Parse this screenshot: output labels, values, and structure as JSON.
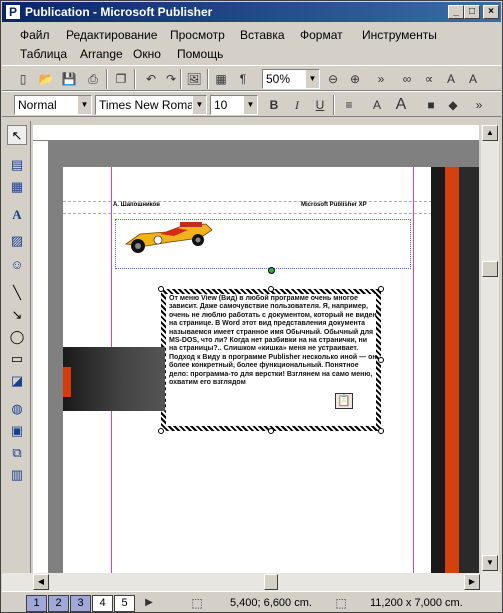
{
  "window": {
    "title": "Publication - Microsoft Publisher"
  },
  "menu": {
    "row1": [
      "Файл",
      "Редактирование",
      "Просмотр",
      "Вставка",
      "Формат",
      "Инструменты"
    ],
    "row2": [
      "Таблица",
      "Arrange",
      "Окно",
      "Помощь"
    ]
  },
  "toolbar": {
    "zoom": "50%"
  },
  "format": {
    "style": "Normal",
    "font": "Times New Roman",
    "size": "10"
  },
  "document": {
    "header_left": "А. Шапошников",
    "header_right": "Microsoft Publisher XP",
    "frame_text": "От меню View (Вид) в любой программе очень многое зависит. Даже самочувствие пользователя. Я, например, очень не люблю работать с документом, который не виден на странице. В Word этот вид представления документа называемся имеет странное имя Обычный. Обычный для MS-DOS, что ли? Когда нет разбивки на на странички, ни на страницы?.. Слишком «кишка» меня не устраивает. Подход к Виду в программе Publisher несколько иной — он более конкретный, более функциональный. Понятное дело: программа-то для верстки! Взглянем на само меню, охватим его взглядом"
  },
  "status": {
    "pages": [
      "1",
      "2",
      "3",
      "4",
      "5"
    ],
    "position": "5,400; 6,600 cm.",
    "size": "11,200 x  7,000 cm."
  }
}
